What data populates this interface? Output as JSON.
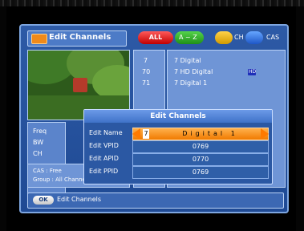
{
  "header": {
    "title": "Edit Channels",
    "sort_options": {
      "all": "ALL",
      "az": "A ~ Z",
      "ch": "CH",
      "cas": "CAS"
    }
  },
  "channel_list": {
    "items": [
      {
        "num": "7",
        "name": "7 Digital",
        "hd": ""
      },
      {
        "num": "70",
        "name": "7 HD Digital",
        "hd": "HD"
      },
      {
        "num": "71",
        "name": "7 Digital 1",
        "hd": ""
      }
    ]
  },
  "left_info": {
    "freq": "Freq",
    "bw": "BW",
    "ch": "CH",
    "cas": "CAS : Free",
    "group": "Group : All Channel"
  },
  "dialog": {
    "title": "Edit Channels",
    "fields": [
      {
        "label": "Edit Name",
        "value": "Digital 1",
        "cursor": "7"
      },
      {
        "label": "Edit VPID",
        "value": "0769"
      },
      {
        "label": "Edit APID",
        "value": "0770"
      },
      {
        "label": "Edit PPID",
        "value": "0769"
      }
    ]
  },
  "status": {
    "ok": "OK",
    "text": "Edit Channels"
  },
  "colors": {
    "osd_blue": "#2d5aa6",
    "accent_orange": "#f07b00",
    "red": "#c00000",
    "green": "#1f8f18",
    "yellow": "#d19a00",
    "blue": "#1e57c7"
  }
}
